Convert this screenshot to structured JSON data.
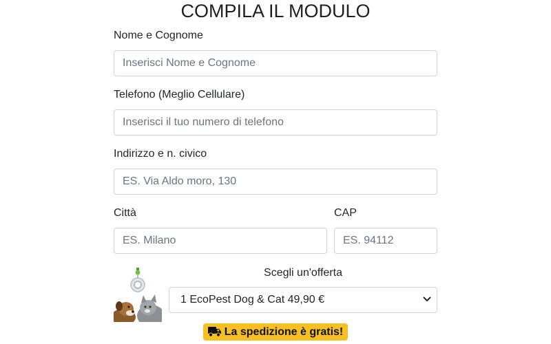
{
  "title": "COMPILA IL MODULO",
  "form": {
    "name": {
      "label": "Nome e Cognome",
      "placeholder": "Inserisci Nome e Cognome"
    },
    "phone": {
      "label": "Telefono (Meglio Cellulare)",
      "placeholder": "Inserisci il tuo numero di telefono"
    },
    "address": {
      "label": "Indirizzo e n. civico",
      "placeholder": "ES. Via Aldo moro, 130"
    },
    "city": {
      "label": "Città",
      "placeholder": "ES. Milano"
    },
    "cap": {
      "label": "CAP",
      "placeholder": "ES. 94112"
    }
  },
  "offer": {
    "label": "Scegli un'offerta",
    "selected": "1 EcoPest Dog & Cat 49,90 €"
  },
  "shipping": {
    "text": "La spedizione è gratis!",
    "icon": "truck-icon",
    "color": "#f6c023"
  }
}
